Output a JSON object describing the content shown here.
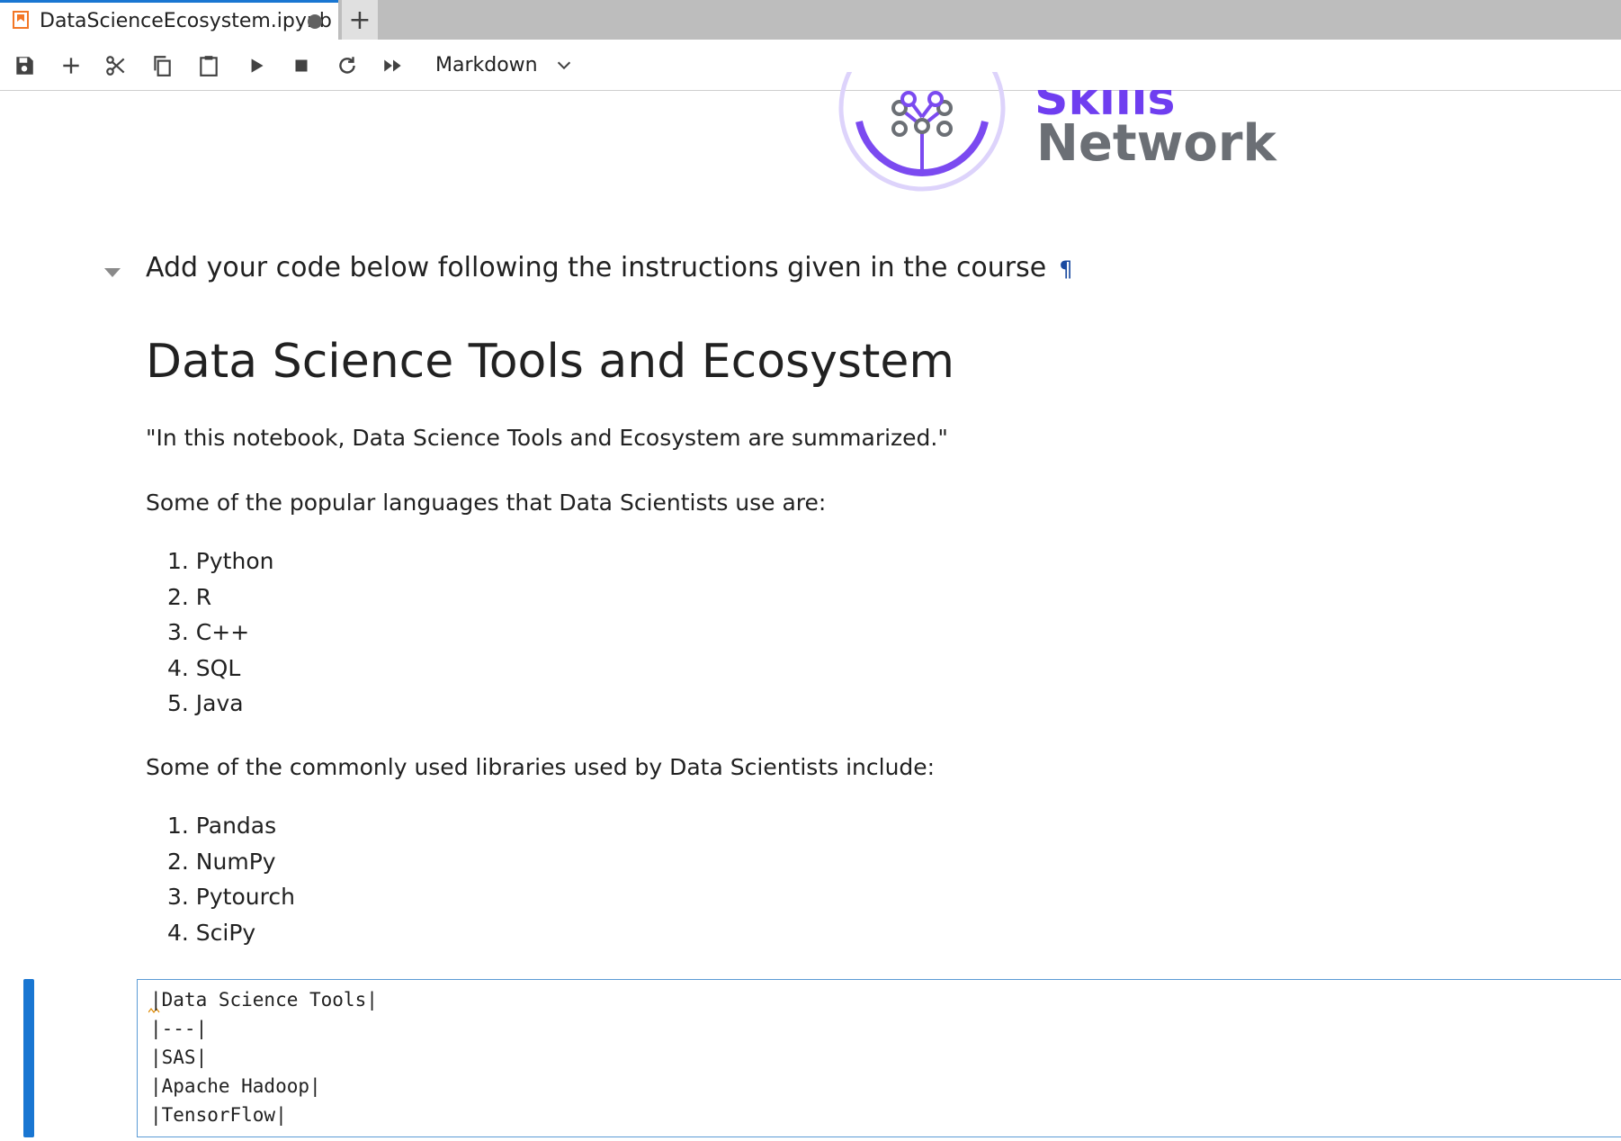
{
  "tab": {
    "title": "DataScienceEcosystem.ipynb",
    "new_tab": "+"
  },
  "toolbar": {
    "buttons": [
      "save-icon",
      "add-cell-icon",
      "cut-icon",
      "copy-icon",
      "paste-icon",
      "run-icon",
      "stop-icon",
      "restart-icon",
      "run-all-icon"
    ],
    "cell_type": "Markdown"
  },
  "logo": {
    "line1": "Skills",
    "line2": "Network"
  },
  "content": {
    "instruction": "Add your code below following the instructions given in the course",
    "anchor": "¶",
    "title": "Data Science Tools and Ecosystem",
    "intro": "\"In this notebook, Data Science Tools and Ecosystem are summarized.\"",
    "languages_heading": "Some of the popular languages that Data Scientists use are:",
    "languages": [
      "1. Python",
      "2. R",
      "3. C++",
      "4. SQL",
      "5. Java"
    ],
    "libraries_heading": "Some of the commonly used libraries used by Data Scientists include:",
    "libraries": [
      "1. Pandas",
      "2. NumPy",
      "3. Pytourch",
      "4. SciPy"
    ]
  },
  "editor": {
    "lines": [
      "|Data Science Tools|",
      "|---|",
      "|SAS|",
      "|Apache Hadoop|",
      "|TensorFlow|"
    ]
  },
  "colors": {
    "accent": "#1976d2",
    "logo_purple": "#6f3ef0",
    "logo_gray": "#6b6f75"
  }
}
